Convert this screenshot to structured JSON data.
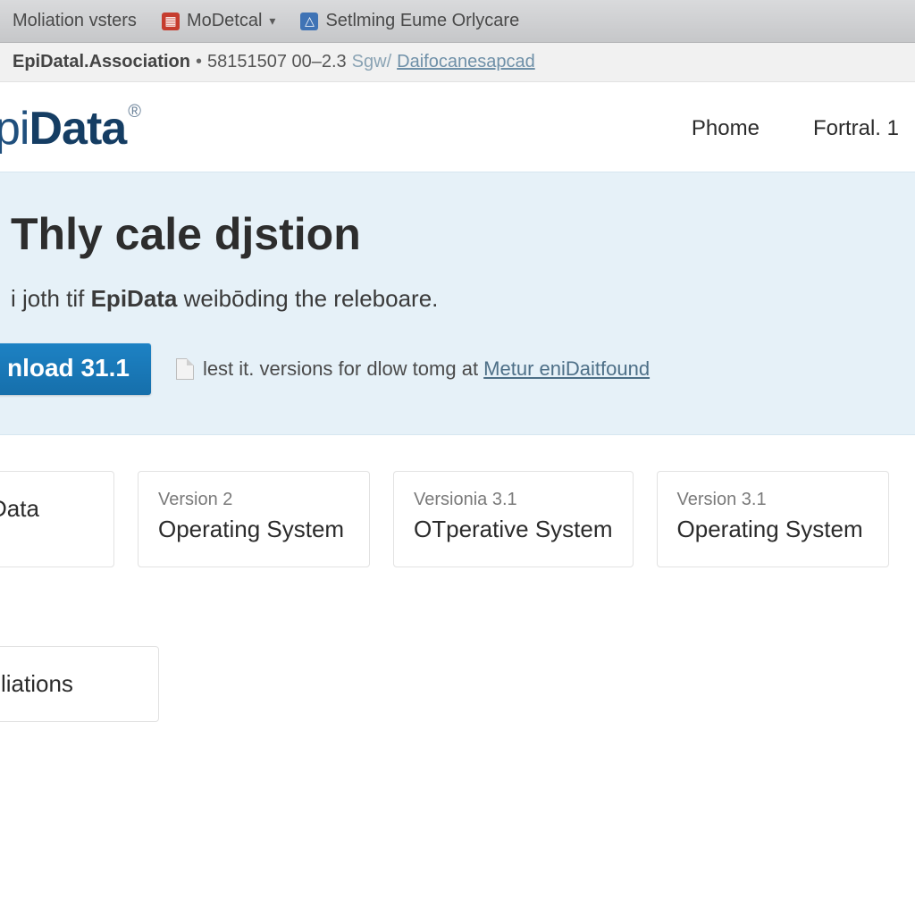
{
  "toolbar": {
    "bookmark1": "Moliation vsters",
    "bookmark2": "MoDetcal",
    "bookmark3": "Setlming Eume Orlycare"
  },
  "address": {
    "site": "EpiDatal.Association",
    "numbers": "58151507  00–2.3",
    "path_prefix": "Sgw/",
    "path_link": "Daifocanesapcad"
  },
  "header": {
    "logo_left": "pi",
    "logo_bold": "Data",
    "nav1": "Phome",
    "nav2": "Fortral. 1"
  },
  "hero": {
    "title": "Thly cale djstion",
    "sub_pre": "i joth tif ",
    "sub_em": "EpiData",
    "sub_post": " weibōding the releboare.",
    "button": "nload 31.1",
    "note_text": "lest it. versions for dlow tomg at ",
    "note_link": "Metur eniDaitfound"
  },
  "cards": [
    {
      "small": "",
      "big": "Data"
    },
    {
      "small": "Version 2",
      "big": "Operating System"
    },
    {
      "small": "Versionia 3.1",
      "big": "OTperative System"
    },
    {
      "small": "Version 3.1",
      "big": "Operating System"
    },
    {
      "small": "",
      "big": "liations"
    }
  ]
}
